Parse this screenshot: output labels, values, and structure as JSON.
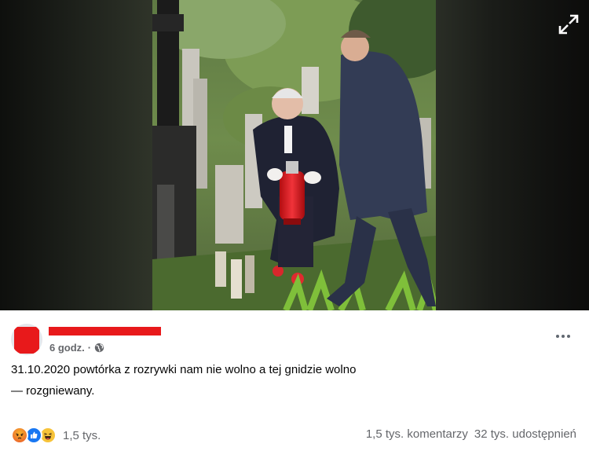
{
  "media": {
    "expand_icon": "expand-arrows-icon"
  },
  "post": {
    "avatar_icon": "avatar-redacted",
    "time": "6 godz.",
    "separator": "·",
    "privacy_icon": "globe-icon",
    "text": "31.10.2020 powtórka z rozrywki nam nie wolno a tej gnidzie wolno",
    "feeling": "— rozgniewany.",
    "more_icon": "more-dots-icon"
  },
  "engagement": {
    "reaction_icons": [
      "angry-icon",
      "like-icon",
      "haha-icon"
    ],
    "reaction_count": "1,5 tys.",
    "comments": "1,5 tys. komentarzy",
    "shares": "32 tys. udostępnień"
  },
  "colors": {
    "redaction": "#e8191b",
    "secondary_text": "#65676b",
    "like_blue": "#1877f2"
  }
}
